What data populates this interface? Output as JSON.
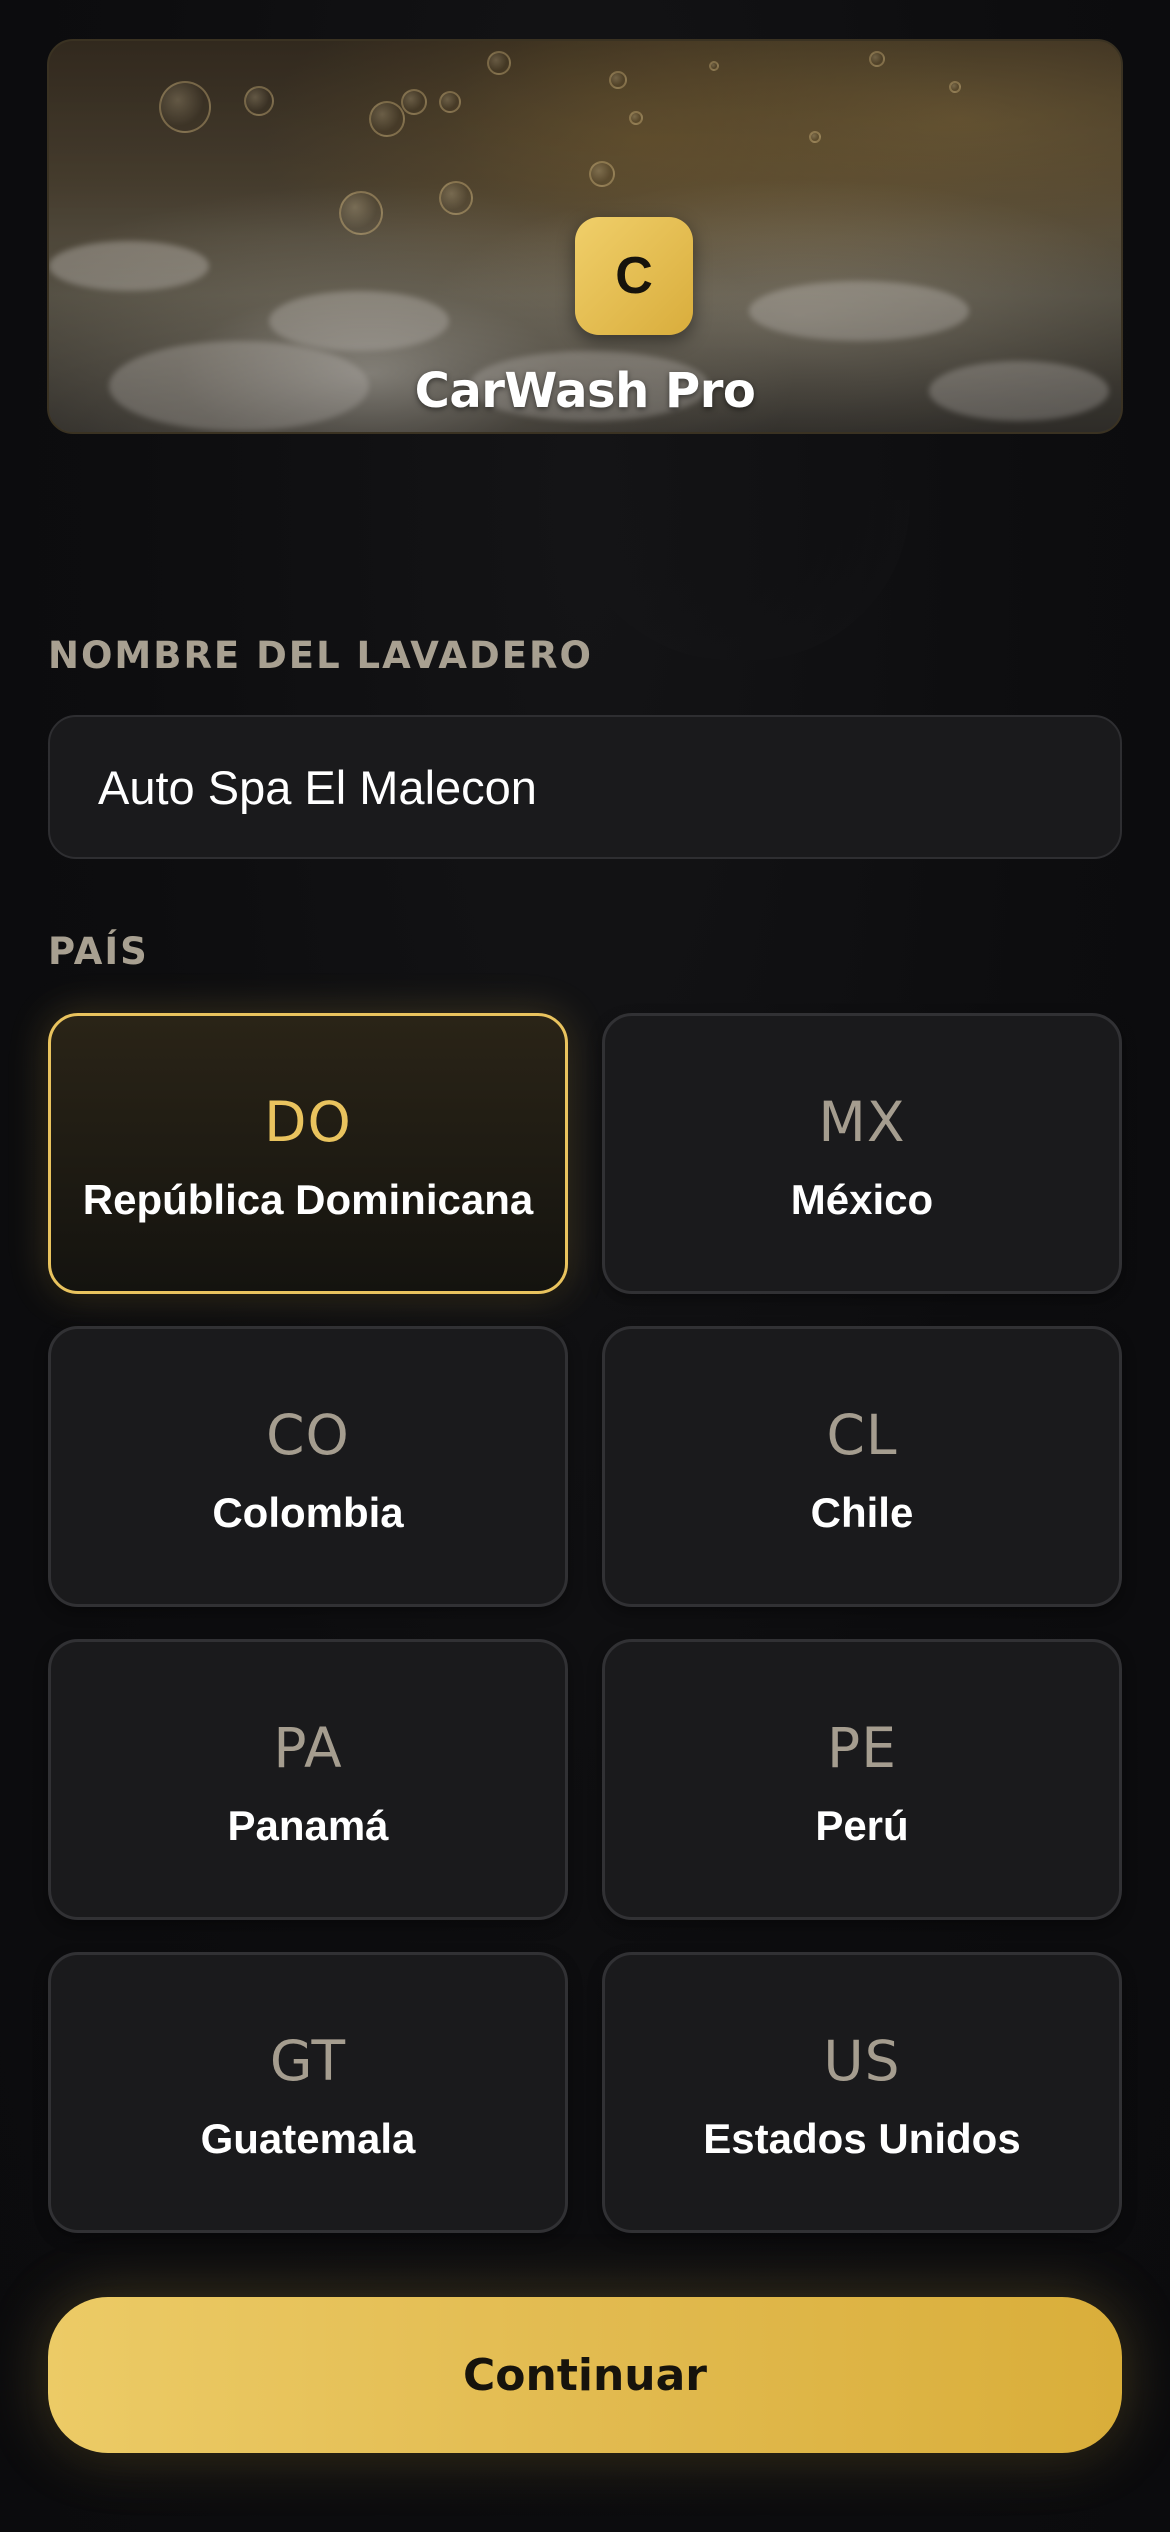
{
  "app": {
    "logo_letter": "C",
    "title": "CarWash Pro"
  },
  "form": {
    "name_label": "NOMBRE DEL LAVADERO",
    "name_value": "Auto Spa El Malecon",
    "country_label": "PAÍS"
  },
  "countries": [
    {
      "code": "DO",
      "name": "República Dominicana",
      "selected": true
    },
    {
      "code": "MX",
      "name": "México",
      "selected": false
    },
    {
      "code": "CO",
      "name": "Colombia",
      "selected": false
    },
    {
      "code": "CL",
      "name": "Chile",
      "selected": false
    },
    {
      "code": "PA",
      "name": "Panamá",
      "selected": false
    },
    {
      "code": "PE",
      "name": "Perú",
      "selected": false
    },
    {
      "code": "GT",
      "name": "Guatemala",
      "selected": false
    },
    {
      "code": "US",
      "name": "Estados Unidos",
      "selected": false
    }
  ],
  "actions": {
    "continue_label": "Continuar"
  },
  "colors": {
    "accent": "#e9c35e",
    "background": "#0d0d0f",
    "card": "#1a1a1c",
    "label": "#a8a091"
  }
}
